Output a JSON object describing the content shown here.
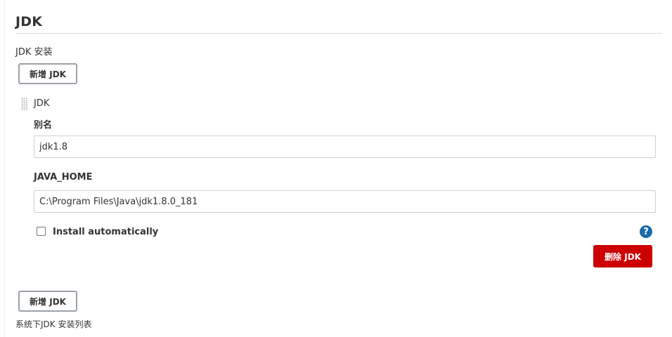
{
  "section": {
    "title": "JDK",
    "install_label": "JDK 安装"
  },
  "buttons": {
    "add_jdk_top": "新增 JDK",
    "add_jdk_bottom": "新增 JDK",
    "delete_jdk": "删除 JDK"
  },
  "jdk_item": {
    "header": "JDK",
    "alias_label": "别名",
    "alias_value": "jdk1.8",
    "java_home_label": "JAVA_HOME",
    "java_home_value": "C:\\Program Files\\Java\\jdk1.8.0_181",
    "install_automatically_label": "Install automatically",
    "install_automatically_checked": false,
    "help_glyph": "?"
  },
  "footer": {
    "description": "系统下JDK 安装列表"
  },
  "colors": {
    "danger": "#cc0003",
    "help": "#1a6aa9"
  }
}
